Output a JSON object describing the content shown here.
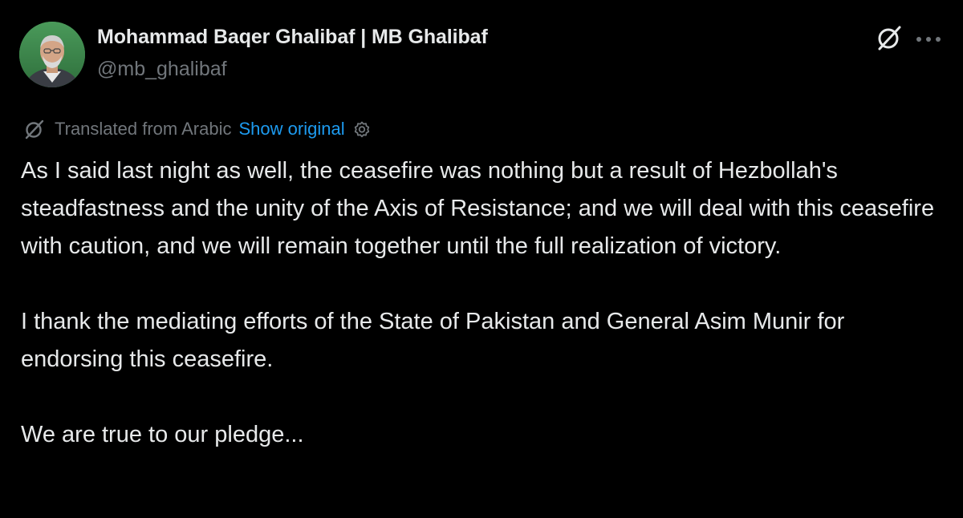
{
  "author": {
    "display_name": "Mohammad Baqer Ghalibaf | MB Ghalibaf",
    "handle": "@mb_ghalibaf",
    "avatar_icon": "profile-photo"
  },
  "header_actions": {
    "grok_icon": "grok-icon",
    "more_icon": "more-horizontal-icon"
  },
  "translation": {
    "icon": "translate-icon",
    "label": "Translated from Arabic",
    "show_original": "Show original",
    "settings_icon": "gear-icon"
  },
  "tweet": {
    "paragraphs": [
      "As I said last night as well, the ceasefire was nothing but a result of Hezbollah's steadfastness and the unity of the Axis of Resistance; and we will deal with this ceasefire with caution, and we will remain together until the full realization of victory.",
      "I thank the mediating efforts of the State of Pakistan and General Asim Munir for endorsing this ceasefire.",
      "We are true to our pledge..."
    ]
  },
  "colors": {
    "background": "#000000",
    "primary_text": "#e7e9ea",
    "secondary_text": "#71767b",
    "link": "#1d9bf0"
  }
}
